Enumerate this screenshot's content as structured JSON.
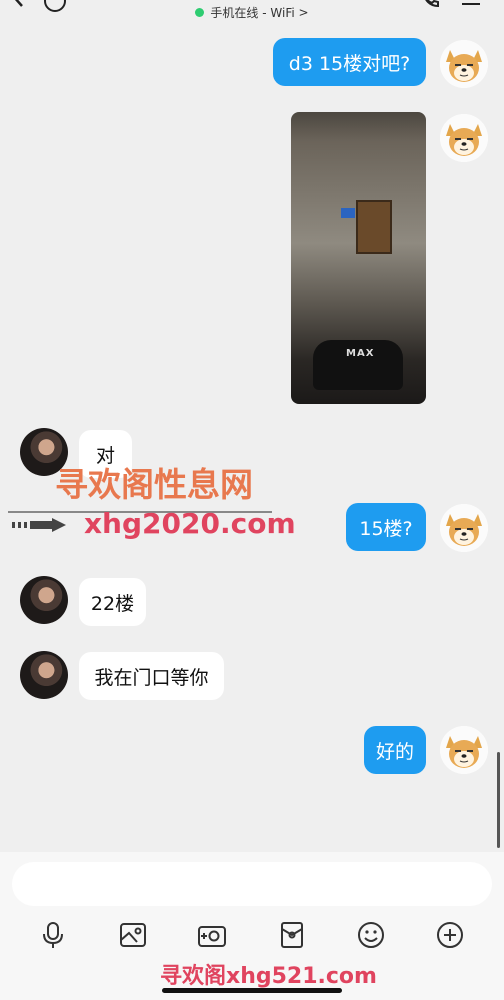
{
  "header": {
    "status_text": "手机在线 - WiFi",
    "status_chevron": ">",
    "status_color": "#2ecc71"
  },
  "messages": [
    {
      "side": "me",
      "text": "d3 15楼对吧?"
    },
    {
      "side": "me",
      "type": "image"
    },
    {
      "side": "her",
      "text": "对"
    },
    {
      "side": "me",
      "text": "15楼?"
    },
    {
      "side": "her",
      "text": "22楼"
    },
    {
      "side": "her",
      "text": "我在门口等你"
    },
    {
      "side": "me",
      "text": "好的"
    }
  ],
  "photo": {
    "logo_text": "MAX"
  },
  "watermark": {
    "line1": "寻欢阁性息网",
    "url": "xhg2020.com",
    "bottom": "寻欢阁xhg521.com"
  },
  "composer": {
    "placeholder": "",
    "tools": [
      "microphone-icon",
      "image-icon",
      "camera-icon",
      "red-packet-icon",
      "emoji-icon",
      "plus-icon"
    ]
  },
  "colors": {
    "my_bubble": "#1e9cf0",
    "their_bubble": "#ffffff",
    "background": "#efefef"
  }
}
